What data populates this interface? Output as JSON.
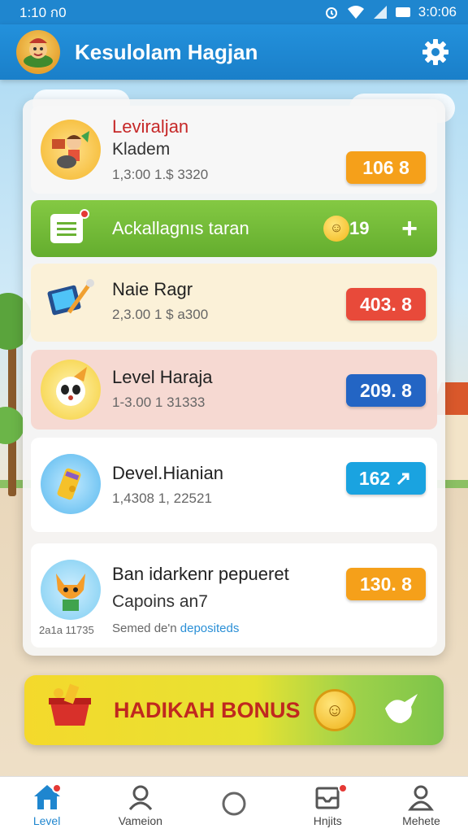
{
  "status_bar": {
    "time_left": "1:10 ก0",
    "time_right": "3:0:06"
  },
  "app_bar": {
    "title": "Kesulolam Hagjan",
    "logo_icon": "mascot-logo-icon",
    "settings_icon": "gear-icon"
  },
  "cards": [
    {
      "name": "Leviraljan",
      "subtitle": "Kladem",
      "meta": "1,3:00 1.$ 3320",
      "value": "106 8",
      "pill_color": "#f5a01a",
      "bg": "#f7f7f7",
      "name_color": "#c62828"
    },
    {
      "name": "Naie Ragr",
      "subtitle": "",
      "meta": "2,3.00 1 $ a300",
      "value": "403. 8",
      "pill_color": "#e84a3a",
      "bg": "#fbf1d8",
      "name_color": "#222222"
    },
    {
      "name": "Level Haraja",
      "subtitle": "",
      "meta": "1-3.00 1 31333",
      "value": "209. 8",
      "pill_color": "#2365c4",
      "bg": "#f6d9d2",
      "name_color": "#222222"
    },
    {
      "name": "Devel.Hianian",
      "subtitle": "",
      "meta": "1,4308 1, 22521",
      "value": "162",
      "pill_color": "#1aa3e0",
      "bg": "#ffffff",
      "name_color": "#222222"
    },
    {
      "name": "Ban idarkenr pepueret",
      "subtitle": "Capoins an7",
      "meta": "Semed de'n",
      "meta_link": "depositeds",
      "avatar_caption": "2a1a 11735",
      "value": "130. 8",
      "pill_color": "#f5a01a",
      "bg": "#ffffff",
      "name_color": "#222222"
    }
  ],
  "action_bar": {
    "label": "Ackallagnıs taran",
    "coin_value": "19",
    "plus": "+"
  },
  "bonus": {
    "label": "HADIKAH BONUS"
  },
  "bottom_nav": [
    {
      "label": "Level",
      "icon": "home-icon",
      "active": true,
      "badge": true
    },
    {
      "label": "Vameion",
      "icon": "profile-icon",
      "active": false,
      "badge": false
    },
    {
      "label": "",
      "icon": "circle-icon",
      "active": false,
      "badge": false
    },
    {
      "label": "Hnjits",
      "icon": "inbox-icon",
      "active": false,
      "badge": true
    },
    {
      "label": "Mehete",
      "icon": "user-icon",
      "active": false,
      "badge": false
    }
  ]
}
